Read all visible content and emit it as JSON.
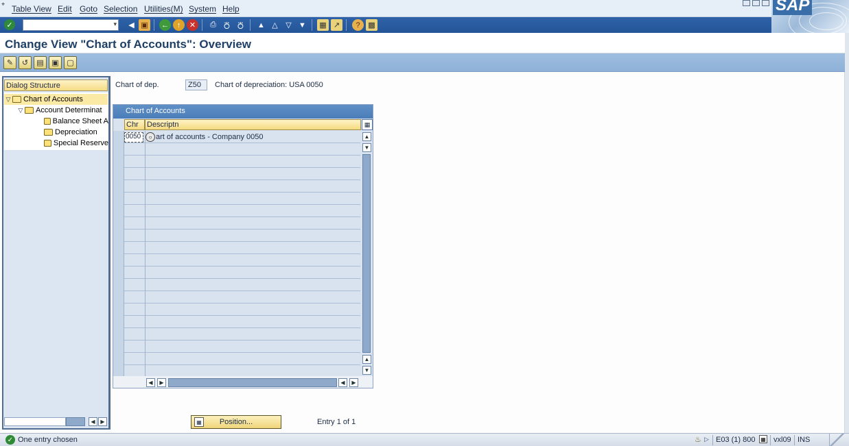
{
  "menubar": {
    "items": [
      "Table View",
      "Edit",
      "Goto",
      "Selection",
      "Utilities(M)",
      "System",
      "Help"
    ],
    "logo_text": "SAP"
  },
  "toolbar": {
    "command_placeholder": "",
    "icons": [
      "enter-icon",
      "back-icon",
      "save-icon",
      "back-green-icon",
      "exit-icon",
      "cancel-icon",
      "print-icon",
      "find-icon",
      "find-next-icon",
      "first-page-icon",
      "prev-page-icon",
      "next-page-icon",
      "last-page-icon",
      "new-session-icon",
      "shortcut-icon",
      "help-icon",
      "layout-icon"
    ]
  },
  "title": "Change View \"Chart of Accounts\": Overview",
  "apptoolbar": {
    "icons": [
      "edit-pencil-icon",
      "display-change-icon",
      "select-all-icon",
      "select-block-icon",
      "deselect-all-icon"
    ]
  },
  "dialog_structure": {
    "header": "Dialog Structure",
    "items": [
      {
        "label": "Chart of Accounts",
        "level": 0,
        "expanded": true,
        "selected": true
      },
      {
        "label": "Account Determinat",
        "level": 1,
        "expanded": true,
        "selected": false
      },
      {
        "label": "Balance Sheet A",
        "level": 2,
        "expanded": false,
        "selected": false
      },
      {
        "label": "Depreciation",
        "level": 2,
        "expanded": false,
        "selected": false
      },
      {
        "label": "Special Reserve",
        "level": 2,
        "expanded": false,
        "selected": false
      }
    ]
  },
  "header_field": {
    "label": "Chart of dep.",
    "value": "Z50",
    "description": "Chart of depreciation: USA 0050"
  },
  "table": {
    "title": "Chart of Accounts",
    "columns": [
      "Chr",
      "Descriptn"
    ],
    "rows": [
      {
        "chr": "0050",
        "descr": "art of accounts - Company 0050"
      }
    ]
  },
  "position_button": "Position...",
  "entry_text": "Entry 1 of 1",
  "status": {
    "message": "One entry chosen",
    "system": "E03 (1) 800",
    "server": "vxl09",
    "mode": "INS"
  },
  "colors": {
    "toolbar_blue": "#2f62a8",
    "app_toolbar": "#9fbedf",
    "title_text": "#1e3f66",
    "tree_selected": "#fbeaa6",
    "status_ok": "#2f8a35"
  }
}
